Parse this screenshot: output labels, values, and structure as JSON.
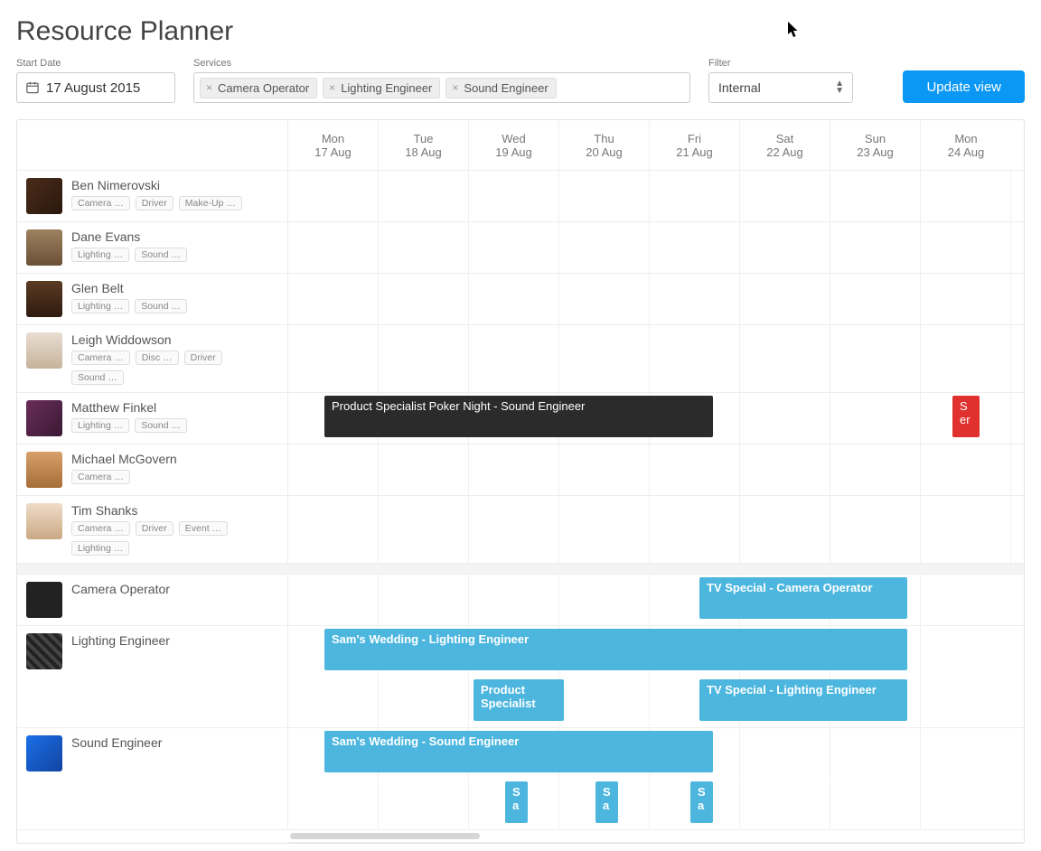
{
  "title": "Resource Planner",
  "labels": {
    "start_date": "Start Date",
    "services": "Services",
    "filter": "Filter",
    "update": "Update view"
  },
  "start_date": "17 August 2015",
  "service_chips": [
    "Camera Operator",
    "Lighting Engineer",
    "Sound Engineer"
  ],
  "filter": {
    "selected": "Internal"
  },
  "days": [
    {
      "dow": "Mon",
      "date": "17 Aug"
    },
    {
      "dow": "Tue",
      "date": "18 Aug"
    },
    {
      "dow": "Wed",
      "date": "19 Aug"
    },
    {
      "dow": "Thu",
      "date": "20 Aug"
    },
    {
      "dow": "Fri",
      "date": "21 Aug"
    },
    {
      "dow": "Sat",
      "date": "22 Aug"
    },
    {
      "dow": "Sun",
      "date": "23 Aug"
    },
    {
      "dow": "Mon",
      "date": "24 Aug"
    }
  ],
  "people": [
    {
      "name": "Ben Nimerovski",
      "tags": [
        "Camera …",
        "Driver",
        "Make-Up …"
      ],
      "avatar": "av1"
    },
    {
      "name": "Dane Evans",
      "tags": [
        "Lighting …",
        "Sound …"
      ],
      "avatar": "av2"
    },
    {
      "name": "Glen Belt",
      "tags": [
        "Lighting …",
        "Sound …"
      ],
      "avatar": "av3"
    },
    {
      "name": "Leigh Widdowson",
      "tags": [
        "Camera …",
        "Disc …",
        "Driver",
        "Sound …"
      ],
      "avatar": "av4"
    },
    {
      "name": "Matthew Finkel",
      "tags": [
        "Lighting …",
        "Sound …"
      ],
      "avatar": "av5",
      "events": [
        {
          "label": "Product Specialist Poker Night - Sound Engineer",
          "start": 0.4,
          "span": 4.3,
          "cls": "ev-dark"
        },
        {
          "label": "S er",
          "start": 7.35,
          "span": 0.3,
          "cls": "ev-red"
        }
      ]
    },
    {
      "name": "Michael McGovern",
      "tags": [
        "Camera …"
      ],
      "avatar": "av6"
    },
    {
      "name": "Tim Shanks",
      "tags": [
        "Camera …",
        "Driver",
        "Event …",
        "Lighting …"
      ],
      "avatar": "av7"
    }
  ],
  "services_section": [
    {
      "name": "Camera Operator",
      "avatar": "av8",
      "tracks": [
        [
          {
            "label": "TV Special - Camera Operator",
            "start": 4.55,
            "span": 2.3,
            "cls": "ev-blue"
          }
        ]
      ]
    },
    {
      "name": "Lighting Engineer",
      "avatar": "av9",
      "tracks": [
        [
          {
            "label": "Sam's Wedding - Lighting Engineer",
            "start": 0.4,
            "span": 6.45,
            "cls": "ev-blue"
          }
        ],
        [
          {
            "label": "Product Specialist",
            "start": 2.05,
            "span": 1.0,
            "cls": "ev-blue"
          },
          {
            "label": "TV Special - Lighting Engineer",
            "start": 4.55,
            "span": 2.3,
            "cls": "ev-blue"
          }
        ]
      ]
    },
    {
      "name": "Sound Engineer",
      "avatar": "av10",
      "tracks": [
        [
          {
            "label": "Sam's Wedding - Sound Engineer",
            "start": 0.4,
            "span": 4.3,
            "cls": "ev-blue"
          }
        ],
        [
          {
            "label": "S a",
            "start": 2.4,
            "span": 0.25,
            "cls": "ev-blue"
          },
          {
            "label": "S a",
            "start": 3.4,
            "span": 0.25,
            "cls": "ev-blue"
          },
          {
            "label": "S a",
            "start": 4.45,
            "span": 0.25,
            "cls": "ev-blue"
          }
        ]
      ]
    }
  ]
}
